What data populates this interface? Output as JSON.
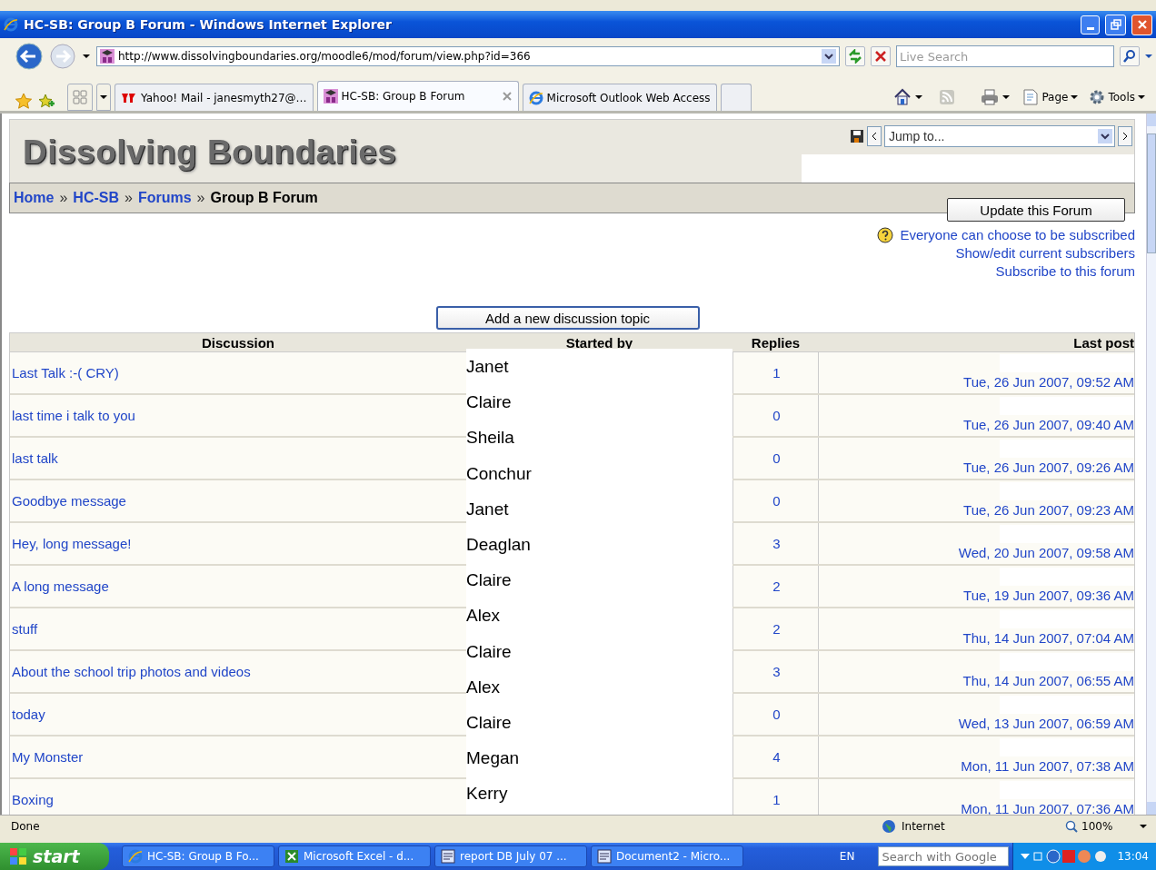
{
  "window": {
    "title": "HC-SB: Group B Forum - Windows Internet Explorer"
  },
  "address_bar": {
    "url": "http://www.dissolvingboundaries.org/moodle6/mod/forum/view.php?id=366",
    "search_placeholder": "Live Search"
  },
  "tabs": [
    {
      "label": "Yahoo! Mail - janesmyth27@…",
      "selected": false
    },
    {
      "label": "HC-SB: Group B Forum",
      "selected": true
    },
    {
      "label": "Microsoft Outlook Web Access",
      "selected": false
    }
  ],
  "command_bar": [
    "Page",
    "Tools"
  ],
  "page": {
    "site_title": "Dissolving Boundaries",
    "jump_placeholder": "Jump to...",
    "breadcrumb": [
      {
        "label": "Home",
        "kind": "link"
      },
      {
        "label": "»",
        "kind": "separator"
      },
      {
        "label": "HC-SB",
        "kind": "link"
      },
      {
        "label": "»",
        "kind": "separator"
      },
      {
        "label": "Forums",
        "kind": "link"
      },
      {
        "label": "»",
        "kind": "separator"
      },
      {
        "label": "Group B Forum",
        "kind": "current"
      }
    ],
    "update_button": "Update this Forum",
    "subscription_links": [
      "Everyone can choose to be subscribed",
      "Show/edit current subscribers",
      "Subscribe to this forum"
    ],
    "add_topic_button": "Add a new discussion topic",
    "columns": [
      "Discussion",
      "Started by",
      "Replies",
      "Last post"
    ],
    "rows": [
      {
        "discussion": "Last Talk :-( CRY)",
        "replies": "1",
        "last_post": "Tue, 26 Jun 2007, 09:52 AM"
      },
      {
        "discussion": "last time i talk to you",
        "replies": "0",
        "last_post": "Tue, 26 Jun 2007, 09:40 AM"
      },
      {
        "discussion": "last talk",
        "replies": "0",
        "last_post": "Tue, 26 Jun 2007, 09:26 AM"
      },
      {
        "discussion": "Goodbye message",
        "replies": "0",
        "last_post": "Tue, 26 Jun 2007, 09:23 AM"
      },
      {
        "discussion": "Hey, long message!",
        "replies": "3",
        "last_post": "Wed, 20 Jun 2007, 09:58 AM"
      },
      {
        "discussion": "A long message",
        "replies": "2",
        "last_post": "Tue, 19 Jun 2007, 09:36 AM"
      },
      {
        "discussion": "stuff",
        "replies": "2",
        "last_post": "Thu, 14 Jun 2007, 07:04 AM"
      },
      {
        "discussion": "About the school trip photos and videos",
        "replies": "3",
        "last_post": "Thu, 14 Jun 2007, 06:55 AM"
      },
      {
        "discussion": "today",
        "replies": "0",
        "last_post": "Wed, 13 Jun 2007, 06:59 AM"
      },
      {
        "discussion": "My Monster",
        "replies": "4",
        "last_post": "Mon, 11 Jun 2007, 07:38 AM"
      },
      {
        "discussion": "Boxing",
        "replies": "1",
        "last_post": "Mon, 11 Jun 2007, 07:36 AM"
      }
    ],
    "started_by_names": [
      "Janet",
      "Claire",
      "Sheila",
      "Conchur",
      "Janet",
      "Deaglan",
      "Claire",
      "Alex",
      "Claire",
      "Alex",
      "Claire",
      "Megan",
      "Kerry"
    ]
  },
  "status_bar": {
    "text": "Done",
    "zone": "Internet",
    "zoom": "100%"
  },
  "taskbar": {
    "start": "start",
    "tasks": [
      "HC-SB: Group B Fo...",
      "Microsoft Excel - d...",
      "report  DB July 07 ...",
      "Document2 - Micro..."
    ],
    "language": "EN",
    "search_placeholder": "Search with Google",
    "clock": "13:04"
  }
}
